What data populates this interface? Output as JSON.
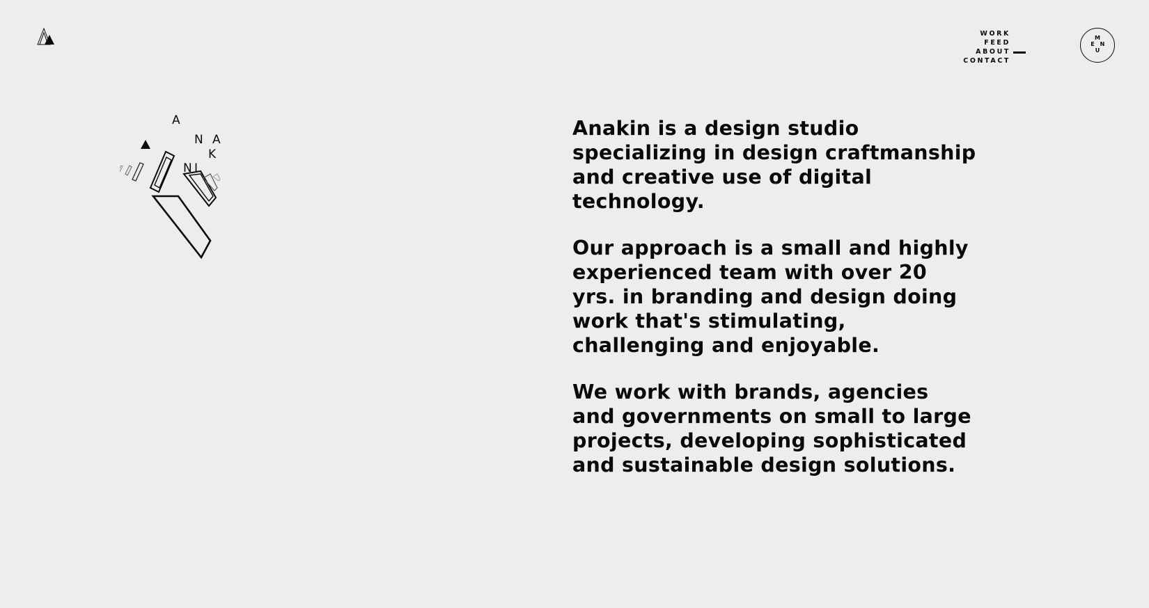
{
  "brand": {
    "logo_icon": "triangle-logo-icon",
    "illustration_icon": "anakin-illustration",
    "illustration_letters": [
      "A",
      "N",
      "A",
      "K",
      "I",
      "N"
    ]
  },
  "nav": {
    "items": [
      {
        "label": "WORK"
      },
      {
        "label": "FEED"
      },
      {
        "label": "ABOUT",
        "active": true
      },
      {
        "label": "CONTACT"
      }
    ],
    "menu_button": {
      "letters": [
        "M",
        "E",
        "N",
        "U"
      ]
    }
  },
  "about": {
    "paragraphs": [
      "Anakin is a design studio specializing in design craftmanship and creative use of digital technology.",
      "Our approach is a small and highly experienced team with over 20 yrs. in branding and design doing work that's stimulating, challenging and enjoyable.",
      "We work with brands, agencies and governments on small to large projects, developing sophisticated and sustainable design solutions."
    ]
  },
  "colors": {
    "background": "#ededed",
    "text": "#0a0a0a"
  }
}
